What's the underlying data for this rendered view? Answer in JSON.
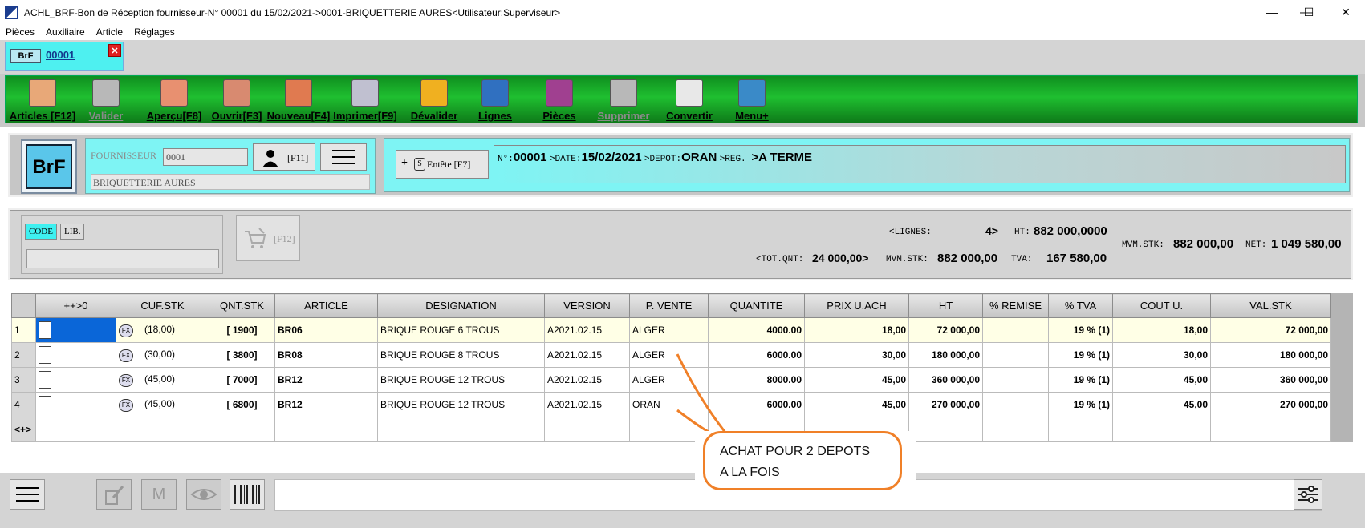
{
  "window": {
    "title": "ACHL_BRF-Bon de Réception fournisseur-N° 00001 du 15/02/2021->0001-BRIQUETTERIE AURES<Utilisateur:Superviseur>",
    "minimize": "—",
    "maximize": "☐",
    "close": "✕"
  },
  "menu": [
    "Pièces",
    "Auxiliaire",
    "Article",
    "Réglages"
  ],
  "doc_tab": {
    "badge": "BrF",
    "number": "00001",
    "close": "✕"
  },
  "toolbar": [
    {
      "label": "Articles [F12]",
      "icon": "articles-icon",
      "enabled": true,
      "color": "#e8a878"
    },
    {
      "label": "Valider",
      "icon": "validate-icon",
      "enabled": false,
      "color": "#b8b8b8"
    },
    {
      "label": "Aperçu[F8]",
      "icon": "preview-icon",
      "enabled": true,
      "color": "#e89070"
    },
    {
      "label": "Ouvrir[F3]",
      "icon": "open-icon",
      "enabled": true,
      "color": "#d88a70"
    },
    {
      "label": "Nouveau[F4]",
      "icon": "new-icon",
      "enabled": true,
      "color": "#e07a50"
    },
    {
      "label": "Imprimer[F9]",
      "icon": "print-icon",
      "enabled": true,
      "color": "#c0c0d0"
    },
    {
      "label": "Dévalider",
      "icon": "unvalidate-icon",
      "enabled": true,
      "color": "#f0b020"
    },
    {
      "label": "Lignes",
      "icon": "lines-search-icon",
      "enabled": true,
      "color": "#3070c0"
    },
    {
      "label": "Pièces",
      "icon": "pieces-icon",
      "enabled": true,
      "color": "#a04090"
    },
    {
      "label": "Supprimer",
      "icon": "delete-icon",
      "enabled": false,
      "color": "#b8b8b8"
    },
    {
      "label": "Convertir",
      "icon": "convert-icon",
      "enabled": true,
      "color": "#e8e8e8"
    },
    {
      "label": "Menu+",
      "icon": "menu-plus-icon",
      "enabled": true,
      "color": "#3a8ac8"
    }
  ],
  "logo_text": "BrF",
  "supplier": {
    "label": "FOURNISSEUR",
    "code": "0001",
    "name": "BRIQUETTERIE AURES",
    "f11": "[F11]"
  },
  "header": {
    "entete_button": "Entête [F7]",
    "plus": "+",
    "s": "S",
    "num_label": "N°:",
    "num": "00001",
    "date_label": ">DATE:",
    "date": "15/02/2021",
    "depot_label": ">DEPOT:",
    "depot": "ORAN",
    "reg_label": ">REG.",
    "reg": ">A TERME"
  },
  "search": {
    "code_chip": "CODE",
    "lib_chip": "LIB.",
    "f12": "[F12]",
    "value": ""
  },
  "totals": {
    "lignes_label": "<LIGNES:",
    "lignes": "4>",
    "ht_label": "HT:",
    "ht": "882 000,0000",
    "mvm_stk_label_1": "MVM.STK:",
    "mvm_stk_1": "882 000,00",
    "net_label": "NET:",
    "net": "1 049 580,00",
    "tot_qnt_label": "<TOT.QNT:",
    "tot_qnt": "24 000,00>",
    "mvm_stk_label_2": "MVM.STK:",
    "mvm_stk_2": "882 000,00",
    "tva_label": "TVA:",
    "tva": "167 580,00"
  },
  "table": {
    "columns": [
      "++>0",
      "CUF.STK",
      "QNT.STK",
      "ARTICLE",
      "DESIGNATION",
      "VERSION",
      "P. VENTE",
      "QUANTITE",
      "PRIX U.ACH",
      "HT",
      "% REMISE",
      "% TVA",
      "COUT U.",
      "VAL.STK"
    ],
    "rows": [
      {
        "n": "1",
        "cuf": "(18,00)",
        "qnt": "[ 1900]",
        "article": "BR06",
        "designation": "BRIQUE ROUGE 6 TROUS",
        "version": "A2021.02.15",
        "pvente": "ALGER",
        "quantite": "4000.00",
        "prix": "18,00",
        "ht": "72 000,00",
        "remise": "",
        "tva": "19 % (1)",
        "cout": "18,00",
        "val": "72 000,00"
      },
      {
        "n": "2",
        "cuf": "(30,00)",
        "qnt": "[ 3800]",
        "article": "BR08",
        "designation": "BRIQUE ROUGE 8 TROUS",
        "version": "A2021.02.15",
        "pvente": "ALGER",
        "quantite": "6000.00",
        "prix": "30,00",
        "ht": "180 000,00",
        "remise": "",
        "tva": "19 % (1)",
        "cout": "30,00",
        "val": "180 000,00"
      },
      {
        "n": "3",
        "cuf": "(45,00)",
        "qnt": "[ 7000]",
        "article": "BR12",
        "designation": "BRIQUE ROUGE 12 TROUS",
        "version": "A2021.02.15",
        "pvente": "ALGER",
        "quantite": "8000.00",
        "prix": "45,00",
        "ht": "360 000,00",
        "remise": "",
        "tva": "19 % (1)",
        "cout": "45,00",
        "val": "360 000,00"
      },
      {
        "n": "4",
        "cuf": "(45,00)",
        "qnt": "[ 6800]",
        "article": "BR12",
        "designation": "BRIQUE ROUGE 12 TROUS",
        "version": "A2021.02.15",
        "pvente": "ORAN",
        "quantite": "6000.00",
        "prix": "45,00",
        "ht": "270 000,00",
        "remise": "",
        "tva": "19 % (1)",
        "cout": "45,00",
        "val": "270 000,00"
      }
    ],
    "add_row": "<+>",
    "fx": "FX"
  },
  "callout": {
    "line1": "ACHAT  POUR 2 DEPOTS",
    "line2": "A LA FOIS"
  },
  "bottom": {
    "m_label": "M"
  }
}
